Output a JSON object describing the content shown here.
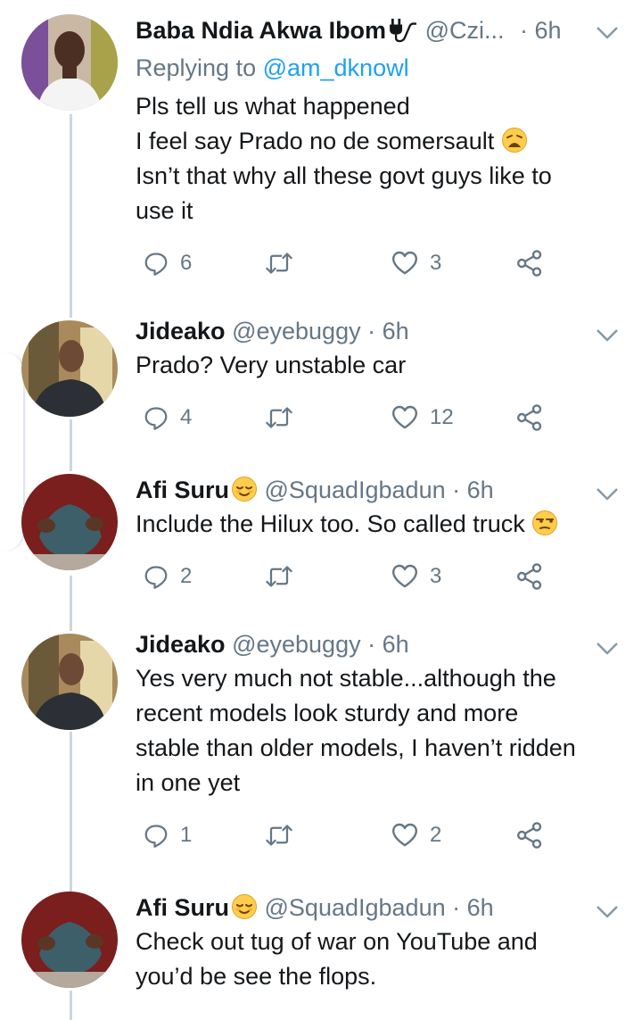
{
  "colors": {
    "text": "#14171a",
    "muted": "#657786",
    "link": "#1da1f2",
    "line": "#ccd6dd"
  },
  "tweets": [
    {
      "name": "Baba Ndia Akwa Ibom",
      "handle": "@Czi...",
      "time": "6h",
      "reply_prefix": "Replying to",
      "reply_mention": "@am_dknowl",
      "lines": [
        "Pls tell us what happened",
        "I feel say Prado no de somersault",
        "Isn’t that why all these govt guys like to",
        "use it"
      ],
      "emojis": [
        "weary-face-emoji"
      ],
      "replies": "6",
      "retweets": "",
      "likes": "3"
    },
    {
      "name": "Jideako",
      "handle": "@eyebuggy",
      "separator": "·",
      "time": "6h",
      "lines": [
        "Prado? Very unstable car"
      ],
      "replies": "4",
      "retweets": "",
      "likes": "12"
    },
    {
      "name": "Afi Suru",
      "handle": "@SquadIgbadun",
      "separator": "·",
      "time": "6h",
      "lines": [
        "Include the Hilux too. So called truck"
      ],
      "emojis": [
        "relieved-face-emoji",
        "unamused-face-emoji"
      ],
      "replies": "2",
      "retweets": "",
      "likes": "3"
    },
    {
      "name": "Jideako",
      "handle": "@eyebuggy",
      "separator": "·",
      "time": "6h",
      "lines": [
        "Yes very much not stable...although the",
        "recent models look sturdy and more",
        "stable than older models, I haven’t ridden",
        "in one yet"
      ],
      "replies": "1",
      "retweets": "",
      "likes": "2"
    },
    {
      "name": "Afi Suru",
      "handle": "@SquadIgbadun",
      "separator": "·",
      "time": "6h",
      "lines": [
        "Check out tug of war on YouTube and",
        "you’d be see the flops."
      ],
      "emojis": [
        "relieved-face-emoji"
      ]
    }
  ],
  "dot_prefix": "·",
  "icons": [
    "reply-icon",
    "retweet-icon",
    "like-icon",
    "share-icon",
    "chevron-down-icon",
    "plug-icon"
  ]
}
